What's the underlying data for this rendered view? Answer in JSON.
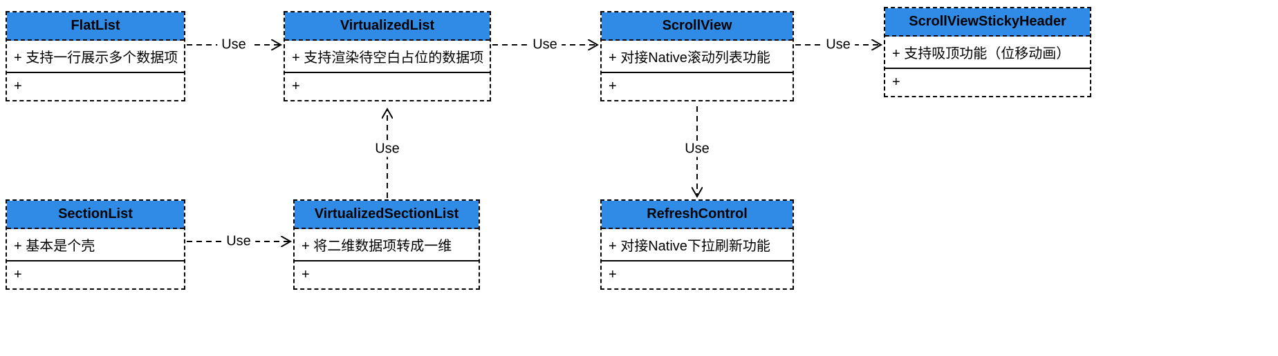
{
  "diagram_type": "UML-class-diagram",
  "edge_label": "Use",
  "classes": {
    "flatlist": {
      "name": "FlatList",
      "attr": "+ 支持一行展示多个数据项",
      "method": "+"
    },
    "virtualized": {
      "name": "VirtualizedList",
      "attr": "+ 支持渲染待空白占位的数据项",
      "method": "+"
    },
    "scrollview": {
      "name": "ScrollView",
      "attr": "+ 对接Native滚动列表功能",
      "method": "+"
    },
    "sticky": {
      "name": "ScrollViewStickyHeader",
      "attr": "+ 支持吸顶功能（位移动画）",
      "method": "+"
    },
    "sectionlist": {
      "name": "SectionList",
      "attr": "+ 基本是个壳",
      "method": "+"
    },
    "vsection": {
      "name": "VirtualizedSectionList",
      "attr": "+ 将二维数据项转成一维",
      "method": "+"
    },
    "refresh": {
      "name": "RefreshControl",
      "attr": "+ 对接Native下拉刷新功能",
      "method": "+"
    }
  },
  "edges": [
    {
      "from": "flatlist",
      "to": "virtualized",
      "label": "Use"
    },
    {
      "from": "virtualized",
      "to": "scrollview",
      "label": "Use"
    },
    {
      "from": "scrollview",
      "to": "sticky",
      "label": "Use"
    },
    {
      "from": "sectionlist",
      "to": "vsection",
      "label": "Use"
    },
    {
      "from": "vsection",
      "to": "virtualized",
      "label": "Use"
    },
    {
      "from": "scrollview",
      "to": "refresh",
      "label": "Use"
    }
  ]
}
